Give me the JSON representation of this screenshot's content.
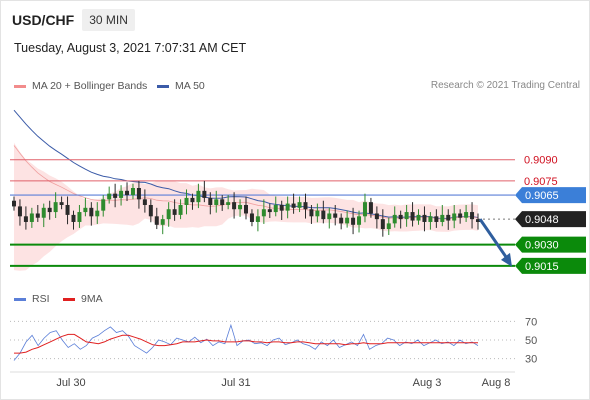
{
  "header": {
    "symbol": "USD/CHF",
    "timeframe": "30 MIN",
    "datetime": "Tuesday, August 3, 2021 7:07:31 AM CET"
  },
  "legend": {
    "ma20": "MA 20 + Bollinger Bands",
    "ma50": "MA 50",
    "copyright": "Research © 2021 Trading Central"
  },
  "rsi_legend": {
    "rsi": "RSI",
    "ma9": "9MA"
  },
  "colors": {
    "resistance": "#e0606a",
    "support": "#0b8a0b",
    "ma50": "#3b5ba8",
    "bollinger": "#fde3e3",
    "current": "#222222",
    "arrow": "#2f5e9e",
    "rsi": "#5b7fd8",
    "rsi_ma": "#e02020",
    "up_candle": "#2e8b2e",
    "down_candle": "#2a2a2a"
  },
  "chart_data": {
    "type": "candlestick",
    "y_range": [
      0.9005,
      0.9135
    ],
    "levels": [
      {
        "value": "0.9090",
        "kind": "resistance"
      },
      {
        "value": "0.9075",
        "kind": "resistance"
      },
      {
        "value": "0.9065",
        "kind": "pivot"
      },
      {
        "value": "0.9048",
        "kind": "current"
      },
      {
        "value": "0.9030",
        "kind": "support"
      },
      {
        "value": "0.9015",
        "kind": "support"
      }
    ],
    "x_ticks": [
      "Jul 30",
      "Jul 31",
      "Aug 3",
      "Aug 8"
    ],
    "forecast_arrow": {
      "from": 0.9048,
      "to": 0.9015
    },
    "close_series": [
      0.9057,
      0.905,
      0.9046,
      0.9052,
      0.9049,
      0.9056,
      0.9053,
      0.906,
      0.9058,
      0.9051,
      0.9046,
      0.9053,
      0.9056,
      0.905,
      0.9054,
      0.9062,
      0.9066,
      0.9063,
      0.9068,
      0.9065,
      0.907,
      0.9062,
      0.9058,
      0.905,
      0.9044,
      0.9048,
      0.9055,
      0.9051,
      0.9058,
      0.9063,
      0.906,
      0.9068,
      0.9063,
      0.9058,
      0.9062,
      0.9058,
      0.906,
      0.9055,
      0.9058,
      0.9052,
      0.9046,
      0.905,
      0.9055,
      0.9053,
      0.9058,
      0.9054,
      0.9059,
      0.9056,
      0.906,
      0.9055,
      0.905,
      0.9054,
      0.9048,
      0.9052,
      0.9049,
      0.9045,
      0.9049,
      0.9044,
      0.905,
      0.906,
      0.9052,
      0.9048,
      0.9041,
      0.9045,
      0.9051,
      0.9048,
      0.9053,
      0.9047,
      0.9051,
      0.9046,
      0.905,
      0.9046,
      0.9051,
      0.9047,
      0.9052,
      0.9049,
      0.9053,
      0.9048,
      0.9046
    ],
    "rsi": {
      "ticks": [
        "70",
        "50",
        "30"
      ],
      "y_range": [
        20,
        80
      ],
      "values": [
        28,
        36,
        48,
        55,
        44,
        52,
        58,
        60,
        50,
        42,
        46,
        40,
        44,
        52,
        55,
        60,
        64,
        58,
        60,
        54,
        44,
        40,
        36,
        42,
        50,
        48,
        45,
        52,
        50,
        48,
        53,
        47,
        51,
        44,
        48,
        46,
        66,
        44,
        49,
        50,
        46,
        47,
        44,
        50,
        52,
        45,
        47,
        50,
        46,
        44,
        40,
        48,
        44,
        50,
        42,
        45,
        48,
        44,
        56,
        40,
        44,
        46,
        52,
        50,
        44,
        48,
        46,
        50,
        44,
        47,
        50,
        46,
        48,
        44,
        50,
        46,
        48,
        44
      ],
      "ma9": [
        36,
        36,
        37,
        40,
        42,
        45,
        48,
        51,
        54,
        56,
        56,
        52,
        48,
        47,
        46,
        48,
        51,
        53,
        55,
        55,
        53,
        51,
        48,
        45,
        44,
        44,
        45,
        46,
        48,
        48,
        48,
        49,
        50,
        49,
        49,
        48,
        48,
        48,
        49,
        49,
        48,
        48,
        47,
        48,
        48,
        47,
        47,
        48,
        48,
        47,
        46,
        46,
        46,
        46,
        46,
        45,
        46,
        46,
        47,
        46,
        46,
        46,
        47,
        47,
        47,
        47,
        47,
        47,
        47,
        47,
        47,
        47,
        47,
        47,
        47,
        47,
        47,
        47
      ]
    }
  }
}
